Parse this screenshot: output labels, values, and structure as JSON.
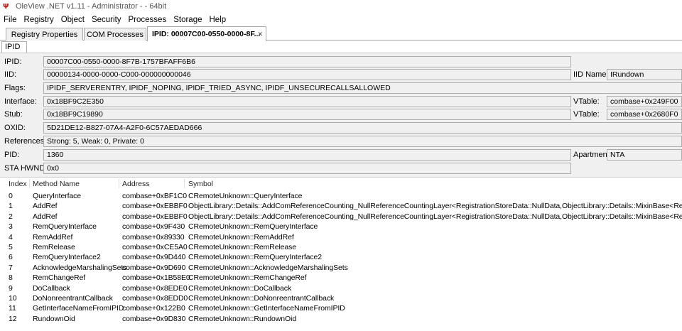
{
  "window": {
    "title": "OleView .NET v1.11 - Administrator - - 64bit"
  },
  "menu": [
    "File",
    "Registry",
    "Object",
    "Security",
    "Processes",
    "Storage",
    "Help"
  ],
  "tabs": [
    {
      "label": "Registry Properties"
    },
    {
      "label": "COM Processes"
    },
    {
      "label": "IPID: 00007C00-0550-0000-8F..."
    }
  ],
  "subtab": {
    "label": "IPID"
  },
  "fields": {
    "ipid": {
      "label": "IPID:",
      "value": "00007C00-0550-0000-8F7B-1757BFAFF6B6"
    },
    "iid": {
      "label": "IID:",
      "value": "00000134-0000-0000-C000-000000000046"
    },
    "iid_name": {
      "label": "IID Name:",
      "value": "IRundown"
    },
    "flags": {
      "label": "Flags:",
      "value": "IPIDF_SERVERENTRY, IPIDF_NOPING, IPIDF_TRIED_ASYNC, IPIDF_UNSECURECALLSALLOWED"
    },
    "interface": {
      "label": "Interface:",
      "value": "0x18BF9C2E350"
    },
    "vtable1": {
      "label": "VTable:",
      "value": "combase+0x249F00"
    },
    "stub": {
      "label": "Stub:",
      "value": "0x18BF9C19890"
    },
    "vtable2": {
      "label": "VTable:",
      "value": "combase+0x2680F0"
    },
    "oxid": {
      "label": "OXID:",
      "value": "5D21DE12-B827-07A4-A2F0-6C57AEDAD666"
    },
    "references": {
      "label": "References:",
      "value": "Strong: 5, Weak: 0, Private: 0"
    },
    "pid": {
      "label": "PID:",
      "value": "1360"
    },
    "apartment": {
      "label": "Apartment:",
      "value": "NTA"
    },
    "sta_hwnd": {
      "label": "STA HWND",
      "value": "0x0"
    }
  },
  "methods": {
    "columns": [
      "Index",
      "Method Name",
      "Address",
      "Symbol"
    ],
    "rows": [
      [
        "0",
        "QueryInterface",
        "combase+0xBF1C0",
        "CRemoteUnknown::QueryInterface"
      ],
      [
        "1",
        "AddRef",
        "combase+0xEBBF0",
        "ObjectLibrary::Details::AddComReferenceCounting_NullReferenceCountingLayer<RegistrationStoreData::NullData,ObjectLibrary::Details::MixinBase<RegistrationStoreData::Nu"
      ],
      [
        "2",
        "AddRef",
        "combase+0xEBBF0",
        "ObjectLibrary::Details::AddComReferenceCounting_NullReferenceCountingLayer<RegistrationStoreData::NullData,ObjectLibrary::Details::MixinBase<RegistrationStoreData::Nu"
      ],
      [
        "3",
        "RemQueryInterface",
        "combase+0x9F430",
        "CRemoteUnknown::RemQueryInterface"
      ],
      [
        "4",
        "RemAddRef",
        "combase+0x89330",
        "CRemoteUnknown::RemAddRef"
      ],
      [
        "5",
        "RemRelease",
        "combase+0xCE5A0",
        "CRemoteUnknown::RemRelease"
      ],
      [
        "6",
        "RemQueryInterface2",
        "combase+0x9D440",
        "CRemoteUnknown::RemQueryInterface2"
      ],
      [
        "7",
        "AcknowledgeMarshalingSets",
        "combase+0x9D690",
        "CRemoteUnknown::AcknowledgeMarshalingSets"
      ],
      [
        "8",
        "RemChangeRef",
        "combase+0x1B58E0",
        "CRemoteUnknown::RemChangeRef"
      ],
      [
        "9",
        "DoCallback",
        "combase+0x8EDE0",
        "CRemoteUnknown::DoCallback"
      ],
      [
        "10",
        "DoNonreentrantCallback",
        "combase+0x8EDD0",
        "CRemoteUnknown::DoNonreentrantCallback"
      ],
      [
        "11",
        "GetInterfaceNameFromIPID",
        "combase+0x122B0",
        "CRemoteUnknown::GetInterfaceNameFromIPID"
      ],
      [
        "12",
        "RundownOid",
        "combase+0x9D830",
        "CRemoteUnknown::RundownOid"
      ]
    ]
  }
}
